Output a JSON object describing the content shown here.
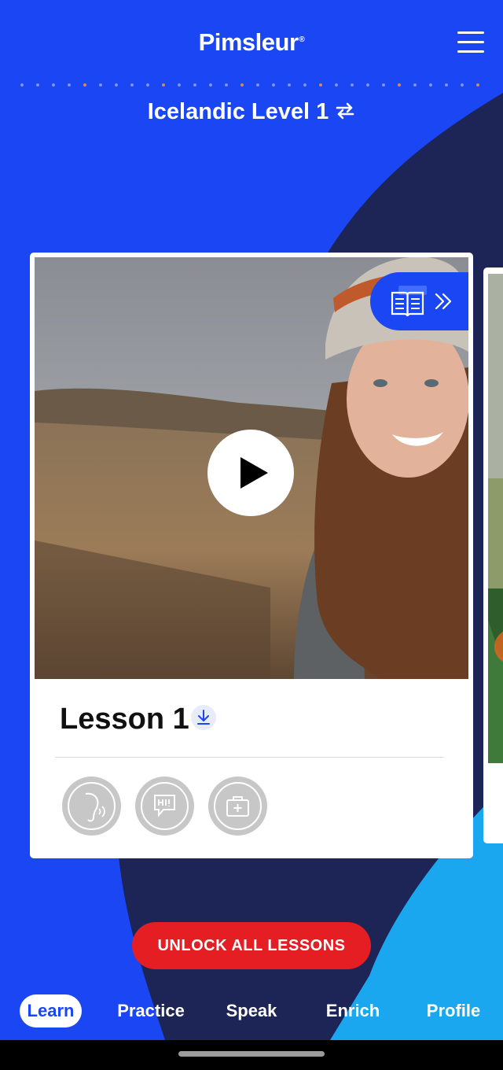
{
  "header": {
    "logo_text": "Pimsleur",
    "logo_mark": "®",
    "menu_icon": "hamburger-menu-icon"
  },
  "progress_dots": {
    "total": 30,
    "current": 1
  },
  "course": {
    "title": "Icelandic Level 1",
    "switch_icon": "swap-arrows-icon"
  },
  "lesson": {
    "title": "Lesson 1",
    "play_icon": "play-icon",
    "reading_icon": "open-book-icon",
    "reading_chevron": "double-chevron-right-icon",
    "download_icon": "download-icon",
    "skills": [
      {
        "icon": "listening-ear-icon"
      },
      {
        "icon": "speech-bubble-hi-icon"
      },
      {
        "icon": "travel-bag-icon"
      }
    ]
  },
  "unlock": {
    "label": "UNLOCK ALL LESSONS"
  },
  "bottom_nav": {
    "items": [
      {
        "label": "Learn",
        "active": true
      },
      {
        "label": "Practice",
        "active": false
      },
      {
        "label": "Speak",
        "active": false
      },
      {
        "label": "Enrich",
        "active": false
      },
      {
        "label": "Profile",
        "active": false
      }
    ]
  },
  "colors": {
    "brand_blue": "#1a46f4",
    "navy": "#1c2556",
    "sky": "#1aa7f0",
    "unlock_red": "#e41e23",
    "skill_grey": "#c7c7c7"
  }
}
